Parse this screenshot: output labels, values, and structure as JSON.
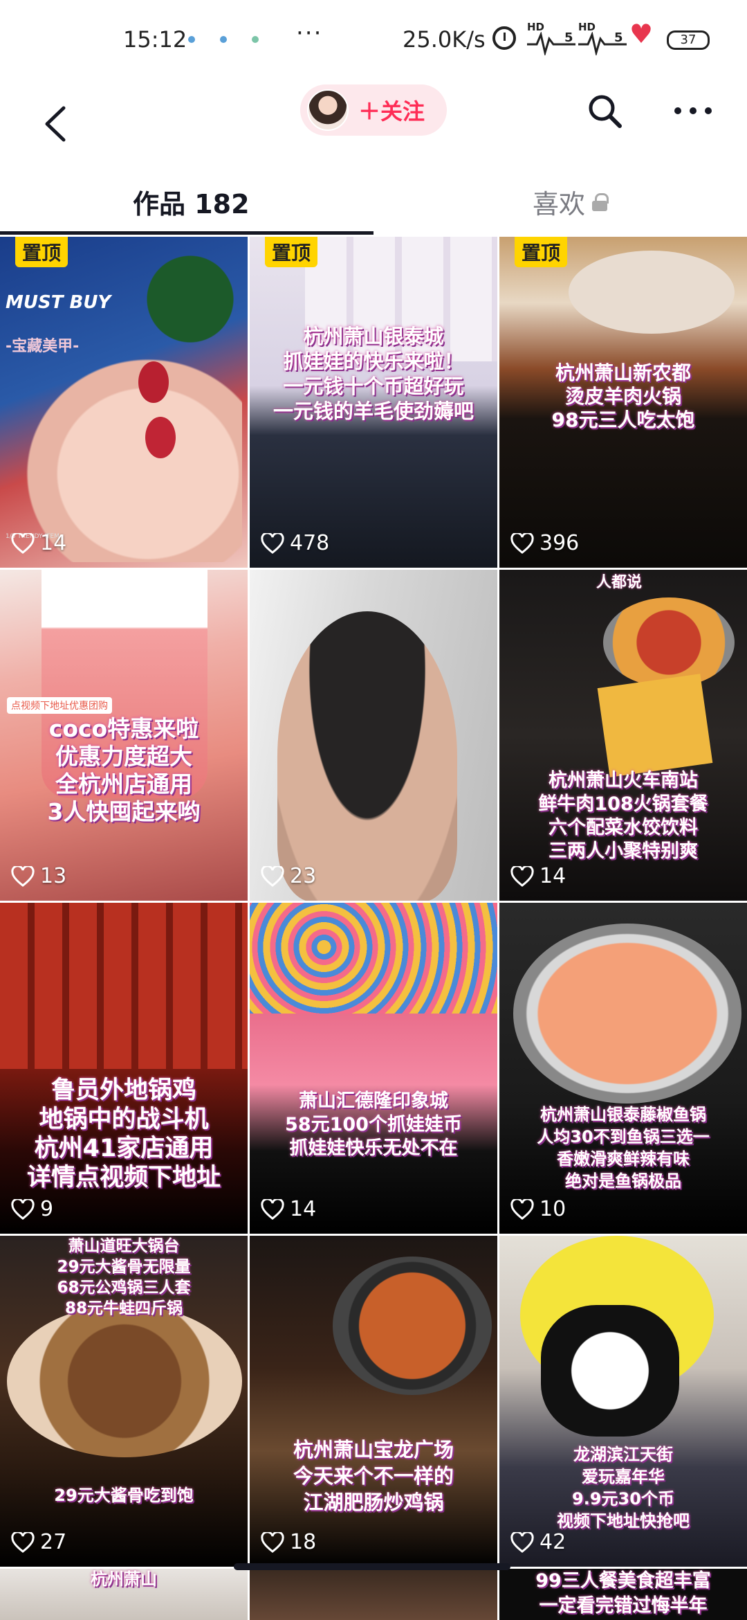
{
  "status": {
    "time": "15:12",
    "more": "···",
    "speed": "25.0K/s",
    "hd1": "HD",
    "hd2": "HD",
    "sig1": "5",
    "sig2": "5",
    "battery": "37"
  },
  "nav": {
    "follow_label": "＋关注",
    "back_icon": "chevron-left-icon",
    "search_icon": "search-icon",
    "more_icon": "more-dots-icon"
  },
  "tabs": {
    "works_label": "作品 182",
    "likes_label": "喜欢"
  },
  "colors": {
    "accent": "#fe2c55",
    "pin": "#ffd400"
  },
  "grid": {
    "tiles": [
      {
        "pinned": "置顶",
        "banner": "MUST BUY",
        "sub": "-宝藏美甲-",
        "caption": "",
        "likes": "14",
        "footer": "1/5 TRENDY ITEM"
      },
      {
        "pinned": "置顶",
        "caption": "杭州萧山银泰城\n抓娃娃的快乐来啦！\n一元钱十个币超好玩\n一元钱的羊毛使劲薅吧",
        "likes": "478"
      },
      {
        "pinned": "置顶",
        "caption": "杭州萧山新农都\n烫皮羊肉火锅\n98元三人吃太饱",
        "likes": "396"
      },
      {
        "pinned": "",
        "small_tag": "点视频下地址优惠团购",
        "caption": "coco特惠来啦\n优惠力度超大\n全杭州店通用\n3人快囤起来哟",
        "likes": "13"
      },
      {
        "pinned": "",
        "caption": "",
        "likes": "23"
      },
      {
        "pinned": "",
        "top_tag": "人都说",
        "caption": "杭州萧山火车南站\n鲜牛肉108火锅套餐\n六个配菜水饺饮料\n三两人小聚特别爽",
        "likes": "14"
      },
      {
        "pinned": "",
        "caption": "鲁员外地锅鸡\n地锅中的战斗机\n杭州41家店通用\n详情点视频下地址",
        "likes": "9"
      },
      {
        "pinned": "",
        "caption": "萧山汇德隆印象城\n58元100个抓娃娃币\n抓娃娃快乐无处不在",
        "likes": "14"
      },
      {
        "pinned": "",
        "caption": "杭州萧山银泰藤椒鱼锅\n人均30不到鱼锅三选一\n香嫩滑爽鲜辣有味\n绝对是鱼锅极品",
        "likes": "10"
      },
      {
        "pinned": "",
        "caption_top": "萧山道旺大锅台\n29元大酱骨无限量\n68元公鸡锅三人套\n88元牛蛙四斤锅",
        "caption": "29元大酱骨吃到饱",
        "likes": "27"
      },
      {
        "pinned": "",
        "caption": "杭州萧山宝龙广场\n今天来个不一样的\n江湖肥肠炒鸡锅",
        "likes": "18"
      },
      {
        "pinned": "",
        "caption": "龙湖滨江天街\n爱玩嘉年华\n9.9元30个币\n视频下地址快抢吧",
        "likes": "42"
      }
    ],
    "partial_captions": [
      "杭州萧山",
      "",
      "99三人餐美食超丰富\n一定看完错过悔半年"
    ]
  }
}
